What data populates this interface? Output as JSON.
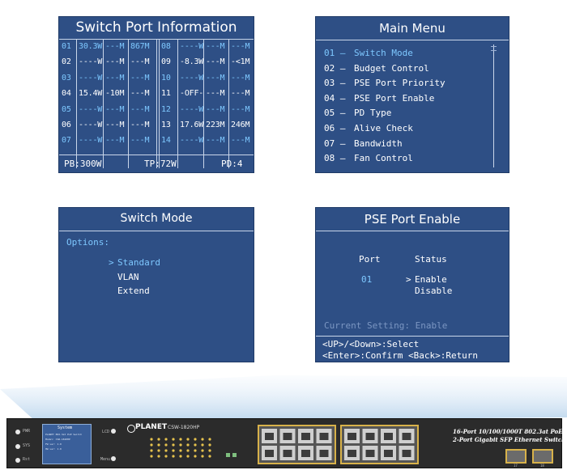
{
  "switch_info": {
    "title": "Switch Port Information",
    "rows": [
      {
        "port": "01",
        "a": "30.3W",
        "b": "---M",
        "c": "867M",
        "port2": "08",
        "a2": "----W",
        "b2": "---M",
        "c2": "---M",
        "color": "cyan"
      },
      {
        "port": "02",
        "a": "----W",
        "b": "---M",
        "c": "---M",
        "port2": "09",
        "a2": "-8.3W",
        "b2": "---M",
        "c2": "-<1M",
        "color": "white"
      },
      {
        "port": "03",
        "a": "----W",
        "b": "---M",
        "c": "---M",
        "port2": "10",
        "a2": "----W",
        "b2": "---M",
        "c2": "---M",
        "color": "cyan"
      },
      {
        "port": "04",
        "a": "15.4W",
        "b": "-10M",
        "c": "---M",
        "port2": "11",
        "a2": "-OFF-",
        "b2": "---M",
        "c2": "---M",
        "color": "white"
      },
      {
        "port": "05",
        "a": "----W",
        "b": "---M",
        "c": "---M",
        "port2": "12",
        "a2": "----W",
        "b2": "---M",
        "c2": "---M",
        "color": "cyan"
      },
      {
        "port": "06",
        "a": "----W",
        "b": "---M",
        "c": "---M",
        "port2": "13",
        "a2": "17.6W",
        "b2": "223M",
        "c2": "246M",
        "color": "white"
      },
      {
        "port": "07",
        "a": "----W",
        "b": "---M",
        "c": "---M",
        "port2": "14",
        "a2": "----W",
        "b2": "---M",
        "c2": "---M",
        "color": "cyan"
      }
    ],
    "footer_pb": "PB:300W",
    "footer_tp": "TP:72W",
    "footer_pd": "PD:4"
  },
  "main_menu": {
    "title": "Main Menu",
    "items": [
      {
        "num": "01 –",
        "label": "Switch Mode"
      },
      {
        "num": "02 –",
        "label": "Budget Control"
      },
      {
        "num": "03 –",
        "label": "PSE Port Priority"
      },
      {
        "num": "04 –",
        "label": "PSE Port Enable"
      },
      {
        "num": "05 –",
        "label": "PD Type"
      },
      {
        "num": "06 –",
        "label": "Alive Check"
      },
      {
        "num": "07 –",
        "label": "Bandwidth"
      },
      {
        "num": "08 –",
        "label": "Fan Control"
      }
    ]
  },
  "switch_mode": {
    "title": "Switch Mode",
    "options_label": "Options:",
    "selector": ">",
    "options": [
      "Standard",
      "VLAN",
      "Extend"
    ]
  },
  "pse_port_enable": {
    "title": "PSE Port Enable",
    "col_port": "Port",
    "col_status": "Status",
    "port_value": "01",
    "selector": ">",
    "status_options": [
      "Enable",
      "Disable"
    ],
    "current_setting": "Current Setting: Enable",
    "help_line1": "<UP>/<Down>:Select",
    "help_line2": "<Enter>:Confirm <Back>:Return"
  },
  "device": {
    "brand": "PLANET",
    "model": "CSW-1820HP",
    "lcd_title": "System",
    "lcd_lines": [
      "PLANET 802.3at PoE Switch",
      "Model: CSW-1820HP",
      "FW ver: 1.0",
      "HW ver: 1.0"
    ],
    "description_line1": "16-Port 10/100/1000T 802.3at PoE +",
    "description_line2": "2-Port Gigabit SFP Ethernet Switch",
    "left_labels": [
      "PWR",
      "SYS",
      "Rst"
    ],
    "mid_labels": [
      "LCD",
      "Menu"
    ],
    "port_numbers_top": [
      "1",
      "2",
      "3",
      "4",
      "5",
      "6",
      "7",
      "8",
      "9",
      "10",
      "11",
      "12",
      "13",
      "14",
      "15",
      "16"
    ],
    "sfp_labels": [
      "17",
      "18"
    ]
  },
  "colors": {
    "panel_bg": "#2e4f85",
    "highlight": "#7ec8ff",
    "device_body": "#2b2b2b",
    "port_gold": "#d8b24a"
  }
}
